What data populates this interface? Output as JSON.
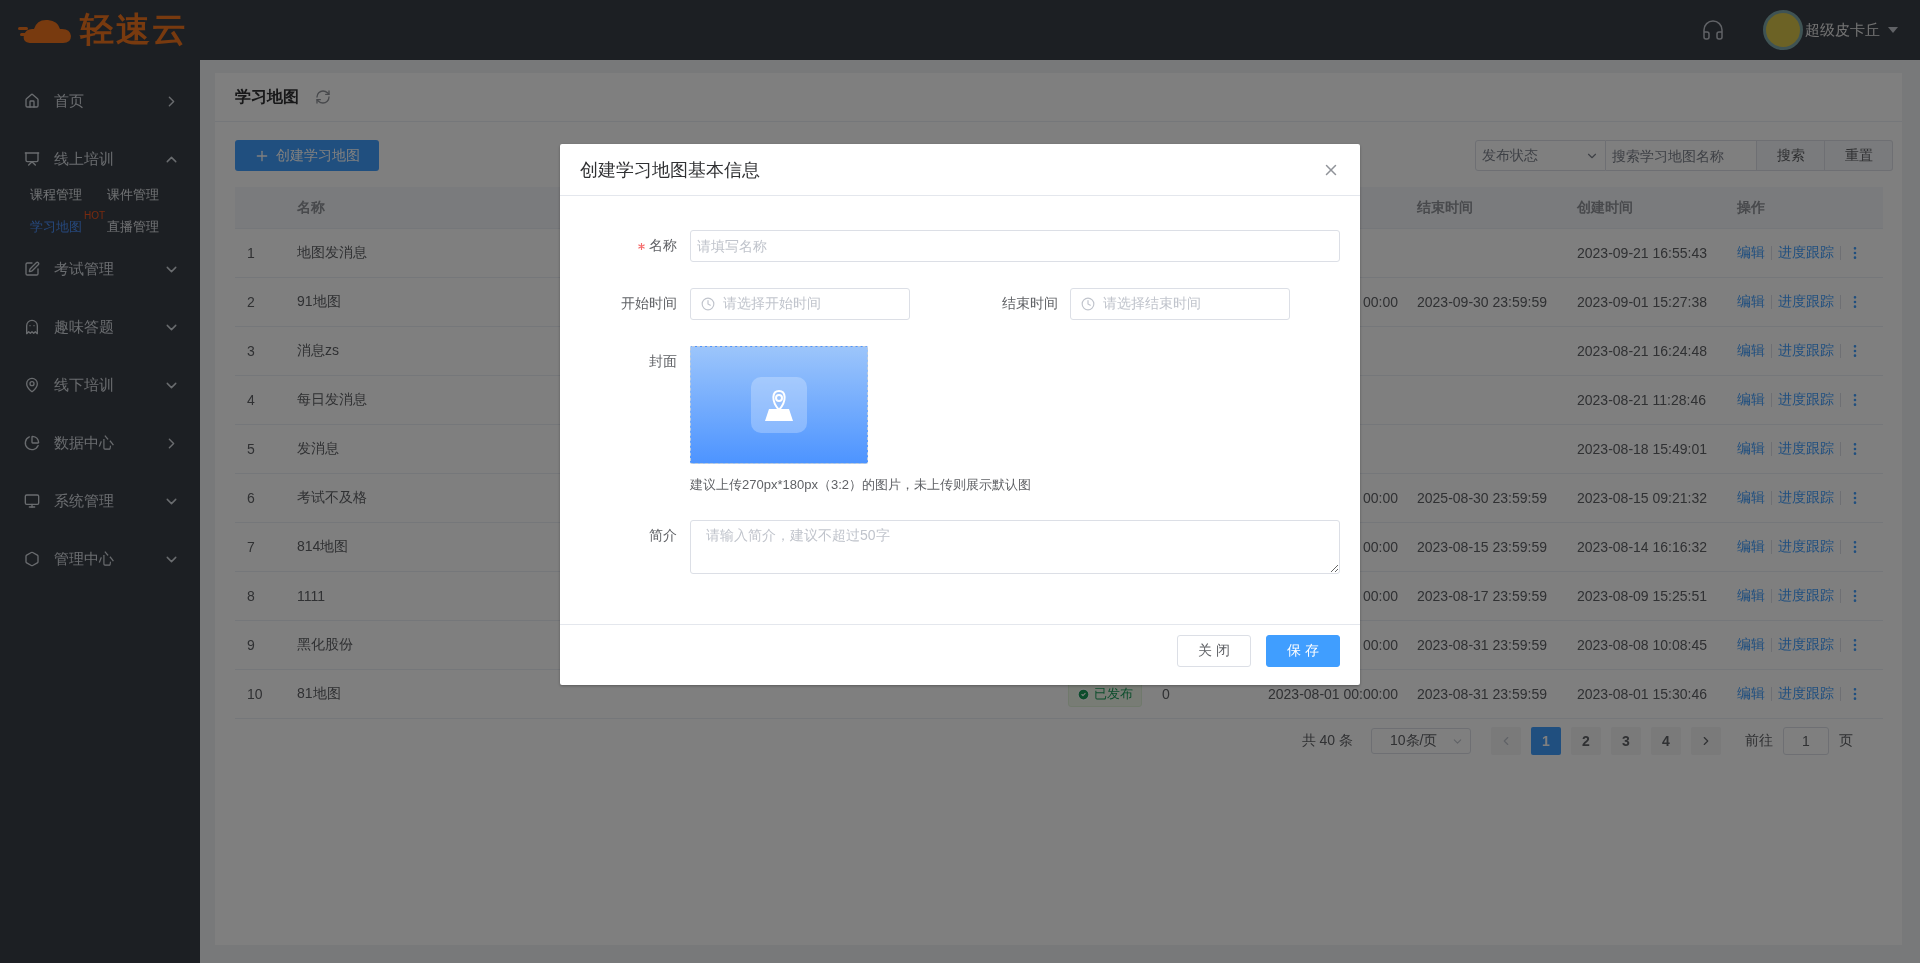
{
  "header": {
    "logo": "轻速云",
    "user": "超级皮卡丘"
  },
  "sidebar": {
    "items": [
      {
        "label": "首页",
        "kind": "link",
        "selected": false
      },
      {
        "label": "线上培训",
        "kind": "group",
        "expanded": true,
        "selected": false,
        "children": [
          {
            "label": "课程管理",
            "selected": false
          },
          {
            "label": "课件管理",
            "selected": false
          },
          {
            "label": "学习地图",
            "selected": true,
            "badge": "HOT"
          },
          {
            "label": "直播管理",
            "selected": false
          }
        ]
      },
      {
        "label": "考试管理",
        "kind": "group",
        "expanded": false,
        "selected": false
      },
      {
        "label": "趣味答题",
        "kind": "group",
        "expanded": false,
        "selected": false
      },
      {
        "label": "线下培训",
        "kind": "group",
        "expanded": false,
        "selected": false
      },
      {
        "label": "数据中心",
        "kind": "link",
        "selected": false
      },
      {
        "label": "系统管理",
        "kind": "group",
        "expanded": false,
        "selected": false
      },
      {
        "label": "管理中心",
        "kind": "group",
        "expanded": false,
        "selected": false
      }
    ]
  },
  "page": {
    "title": "学习地图",
    "create_button": "创建学习地图",
    "filter": {
      "status_placeholder": "发布状态",
      "search_placeholder": "搜索学习地图名称",
      "search_button": "搜索",
      "reset_button": "重置"
    }
  },
  "table": {
    "columns": {
      "name": "名称",
      "end_time": "结束时间",
      "created": "创建时间",
      "actions": "操作"
    },
    "rows": [
      {
        "index": "1",
        "name": "地图发消息",
        "created": "2023-09-21 16:55:43",
        "actions": [
          "编辑",
          "进度跟踪"
        ]
      },
      {
        "index": "2",
        "name": "91地图",
        "column_5": "00:00",
        "end_time": "2023-09-30 23:59:59",
        "created": "2023-09-01 15:27:38",
        "actions": [
          "编辑",
          "进度跟踪"
        ]
      },
      {
        "index": "3",
        "name": "消息zs",
        "created": "2023-08-21 16:24:48",
        "actions": [
          "编辑",
          "进度跟踪"
        ]
      },
      {
        "index": "4",
        "name": "每日发消息",
        "created": "2023-08-21 11:28:46",
        "actions": [
          "编辑",
          "进度跟踪"
        ]
      },
      {
        "index": "5",
        "name": "发消息",
        "created": "2023-08-18 15:49:01",
        "actions": [
          "编辑",
          "进度跟踪"
        ]
      },
      {
        "index": "6",
        "name": "考试不及格",
        "column_5": "00:00",
        "end_time": "2025-08-30 23:59:59",
        "created": "2023-08-15 09:21:32",
        "actions": [
          "编辑",
          "进度跟踪"
        ]
      },
      {
        "index": "7",
        "name": "814地图",
        "column_5": "00:00",
        "end_time": "2023-08-15 23:59:59",
        "created": "2023-08-14 16:16:32",
        "actions": [
          "编辑",
          "进度跟踪"
        ]
      },
      {
        "index": "8",
        "name": "1111",
        "column_5": "00:00",
        "end_time": "2023-08-17 23:59:59",
        "created": "2023-08-09 15:25:51",
        "actions": [
          "编辑",
          "进度跟踪"
        ]
      },
      {
        "index": "9",
        "name": "黑化股份",
        "column_5": "00:00",
        "end_time": "2023-08-31 23:59:59",
        "created": "2023-08-08 10:08:45",
        "actions": [
          "编辑",
          "进度跟踪"
        ]
      },
      {
        "index": "10",
        "name": "81地图",
        "column_3": "已发布",
        "column_4": "0",
        "column_5": "2023-08-01 00:00:00",
        "end_time": "2023-08-31 23:59:59",
        "created": "2023-08-01 15:30:46",
        "actions": [
          "编辑",
          "进度跟踪"
        ]
      }
    ]
  },
  "pagination": {
    "total": "共 40 条",
    "page_size": "10条/页",
    "pages": [
      {
        "label": "1",
        "selected": true
      },
      {
        "label": "2",
        "selected": false
      },
      {
        "label": "3",
        "selected": false
      },
      {
        "label": "4",
        "selected": false
      }
    ],
    "goto_label": "前往",
    "goto_value": "1",
    "goto_suffix": "页"
  },
  "dialog": {
    "title": "创建学习地图基本信息",
    "name": {
      "label": "名称",
      "required": true,
      "placeholder": "请填写名称"
    },
    "start": {
      "label": "开始时间",
      "placeholder": "请选择开始时间"
    },
    "end": {
      "label": "结束时间",
      "placeholder": "请选择结束时间"
    },
    "cover": {
      "label": "封面",
      "hint": "建议上传270px*180px（3:2）的图片，未上传则展示默认图"
    },
    "intro": {
      "label": "简介",
      "placeholder": "请输入简介，建议不超过50字"
    },
    "buttons": [
      "关 闭",
      "保 存"
    ]
  }
}
